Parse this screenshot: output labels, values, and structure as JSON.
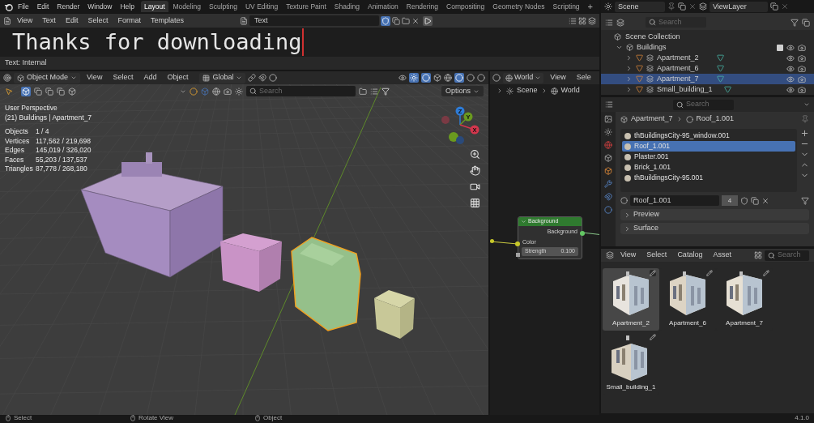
{
  "topbar": {
    "menus": [
      "File",
      "Edit",
      "Render",
      "Window",
      "Help"
    ],
    "workspaces": [
      {
        "label": "Layout",
        "selected": true
      },
      {
        "label": "Modeling",
        "selected": false
      },
      {
        "label": "Sculpting",
        "selected": false
      },
      {
        "label": "UV Editing",
        "selected": false
      },
      {
        "label": "Texture Paint",
        "selected": false
      },
      {
        "label": "Shading",
        "selected": false
      },
      {
        "label": "Animation",
        "selected": false
      },
      {
        "label": "Rendering",
        "selected": false
      },
      {
        "label": "Compositing",
        "selected": false
      },
      {
        "label": "Geometry Nodes",
        "selected": false
      },
      {
        "label": "Scripting",
        "selected": false
      }
    ],
    "add_tab": "+"
  },
  "text_editor": {
    "menus": [
      "View",
      "Text",
      "Edit",
      "Select",
      "Format",
      "Templates"
    ],
    "text_name": "Text",
    "content": "Thanks for downloading",
    "footer": "Text: Internal"
  },
  "viewport": {
    "mode": "Object Mode",
    "menus": [
      "View",
      "Select",
      "Add",
      "Object"
    ],
    "orientation": "Global",
    "search_placeholder": "Search",
    "options": "Options",
    "info": [
      "User Perspective",
      "(21) Buildings | Apartment_7"
    ],
    "stats": [
      {
        "label": "Objects",
        "value": "1 / 4"
      },
      {
        "label": "Vertices",
        "value": "117,562 / 219,698"
      },
      {
        "label": "Edges",
        "value": "145,019 / 326,020"
      },
      {
        "label": "Faces",
        "value": "55,203 / 137,537"
      },
      {
        "label": "Triangles",
        "value": "87,778 / 268,180"
      }
    ],
    "gizmo_axes": [
      {
        "label": "Z",
        "color": "#2e7bd6"
      },
      {
        "label": "Y",
        "color": "#6a9a1f"
      },
      {
        "label": "X",
        "color": "#d4364d"
      }
    ]
  },
  "node_editor": {
    "world": "World",
    "menus": [
      "View",
      "Sele"
    ],
    "breadcrumb": [
      "Scene",
      "World"
    ],
    "node": {
      "title": "Background",
      "output": "Background",
      "input": "Color",
      "field_label": "Strength",
      "field_value": "0.100"
    }
  },
  "outliner": {
    "scene": "Scene",
    "view_layer": "ViewLayer",
    "search_placeholder": "Search",
    "root": "Scene Collection",
    "collection": {
      "name": "Buildings",
      "expanded": true,
      "checked": true,
      "children": [
        {
          "name": "Apartment_2",
          "selected": false,
          "expanded": false
        },
        {
          "name": "Apartment_6",
          "selected": false,
          "expanded": false
        },
        {
          "name": "Apartment_7",
          "selected": true,
          "expanded": false
        },
        {
          "name": "Small_building_1",
          "selected": false,
          "expanded": false
        }
      ]
    }
  },
  "properties": {
    "search_placeholder": "Search",
    "breadcrumb": [
      "Apartment_7",
      "Roof_1.001"
    ],
    "materials": [
      {
        "name": "thBuildingsCity-95_window.001",
        "selected": false
      },
      {
        "name": "Roof_1.001",
        "selected": true
      },
      {
        "name": "Plaster.001",
        "selected": false
      },
      {
        "name": "Brick_1.001",
        "selected": false
      },
      {
        "name": "thBuildingsCity-95.001",
        "selected": false
      }
    ],
    "material_name": "Roof_1.001",
    "users": "4",
    "panels": [
      {
        "label": "Preview",
        "expanded": false
      },
      {
        "label": "Surface",
        "expanded": false
      }
    ]
  },
  "asset_browser": {
    "menus": [
      "View",
      "Select",
      "Catalog",
      "Asset"
    ],
    "search_placeholder": "Search",
    "assets": [
      {
        "name": "Apartment_2",
        "selected": true,
        "kind": "picture"
      },
      {
        "name": "Apartment_6",
        "selected": false,
        "kind": "picture"
      },
      {
        "name": "Apartment_7",
        "selected": false,
        "kind": "picture"
      },
      {
        "name": "Small_building_1",
        "selected": false,
        "kind": "picture"
      }
    ]
  },
  "status_bar": {
    "items": [
      "Select",
      "Rotate View",
      "Object"
    ],
    "version": "4.1.0"
  }
}
